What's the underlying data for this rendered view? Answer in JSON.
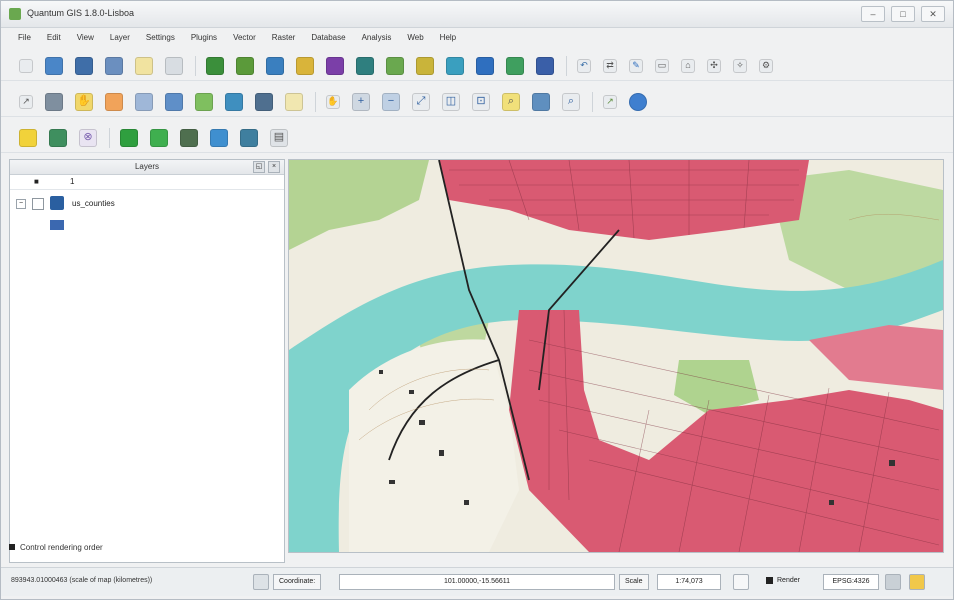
{
  "window": {
    "title": "Quantum GIS 1.8.0-Lisboa"
  },
  "window_buttons": [
    "–",
    "□",
    "✕"
  ],
  "menu": [
    "File",
    "Edit",
    "View",
    "Layer",
    "Settings",
    "Plugins",
    "Vector",
    "Raster",
    "Database",
    "Analysis",
    "Web",
    "Help"
  ],
  "layers_panel": {
    "title": "Layers",
    "header_cols": [
      "■",
      "1"
    ],
    "layers": [
      {
        "name": "us_counties"
      }
    ],
    "render_label": "Control rendering order"
  },
  "status": {
    "message": "893943.01000463 (scale of map (kilometres))",
    "coordinate_label": "Coordinate:",
    "coordinate_value": "101.00000,-15.56611",
    "scale_label": "Scale",
    "scale_value": "1:74,073",
    "render_label": "Render",
    "crs": "EPSG:4326"
  },
  "icons": {
    "toolbar1": [
      "new-icon",
      "open-icon",
      "save-icon",
      "save-as-icon",
      "new-print-icon",
      "print-manager-icon",
      "add-vector-icon",
      "add-raster-icon",
      "add-postgis-icon",
      "add-spatialite-icon",
      "add-wms-icon",
      "add-wfs-icon",
      "add-delimited-icon",
      "add-gpx-icon",
      "new-shapefile-icon",
      "new-spatialite-icon",
      "remove-layer-icon",
      "python-icon",
      "pan-icon",
      "digitize-icon",
      "edit-icon",
      "node-icon",
      "move-icon",
      "split-icon",
      "settings-icon",
      "style-icon"
    ],
    "toolbar2": [
      "pan-map-icon",
      "navigate-icon",
      "touch-icon",
      "identify-icon",
      "select-icon",
      "measure-icon",
      "annotation-icon",
      "map-tips-icon",
      "bookmark-icon",
      "tile-icon",
      "label-icon",
      "zoom-in-icon",
      "zoom-out-icon",
      "zoom-full-icon",
      "zoom-layer-icon",
      "zoom-selection-icon",
      "zoom-last-icon",
      "zoom-next-icon",
      "refresh-icon",
      "help-icon"
    ],
    "toolbar3": [
      "label-tool-icon",
      "rotate-label-icon",
      "pin-icon",
      "grass-icon",
      "grass-tools-icon",
      "grass-mapset-icon",
      "grass-display-icon",
      "grass-region-icon",
      "grass-close-icon"
    ]
  },
  "colors": {
    "urban": "#d95a72",
    "river": "#7fd3cc",
    "vegetation": "#9cc97a",
    "paper": "#f2efe4"
  }
}
